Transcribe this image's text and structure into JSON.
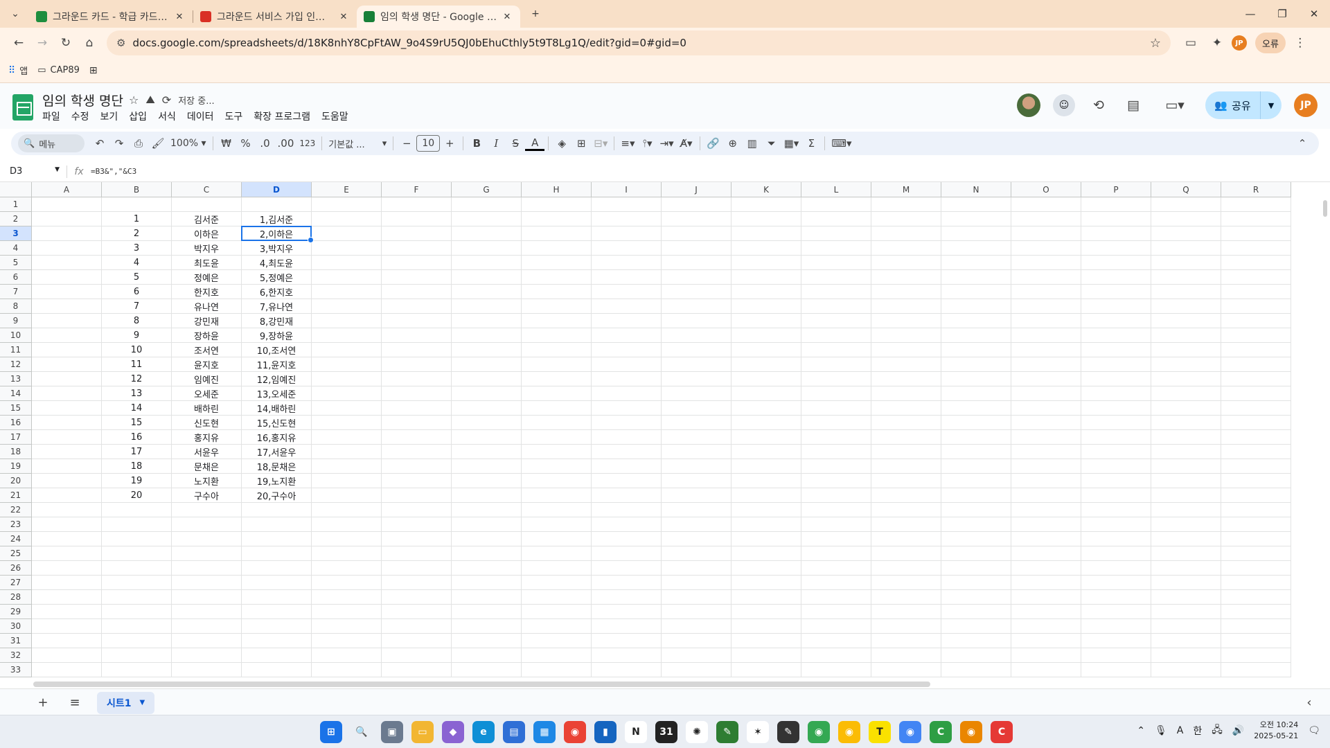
{
  "browser": {
    "tabs": [
      {
        "title": "그라운드 카드 - 학급 카드 관리",
        "active": false,
        "color": "#1e8e3e"
      },
      {
        "title": "그라운드 서비스 가입 인증 이메일",
        "active": false,
        "color": "#d93025"
      },
      {
        "title": "임의 학생 명단 - Google Sheets",
        "active": true,
        "color": "#188038"
      }
    ],
    "url": "docs.google.com/spreadsheets/d/18K8nhY8CpFtAW_9o4S9rU5QJ0bEhuCthly5t9T8Lg1Q/edit?gid=0#gid=0",
    "profile_initials": "JP",
    "error_label": "오류",
    "bookmarks": [
      {
        "label": "앱",
        "icon": "apps-icon"
      },
      {
        "label": "CAP89",
        "icon": "folder-icon"
      }
    ]
  },
  "doc": {
    "title": "임의 학생 명단",
    "save_status": "저장 중...",
    "menu": [
      "파일",
      "수정",
      "보기",
      "삽입",
      "서식",
      "데이터",
      "도구",
      "확장 프로그램",
      "도움말"
    ],
    "share_label": "공유",
    "avatar_initials": "JP"
  },
  "toolbar": {
    "menu_search": "메뉴",
    "zoom": "100%",
    "currency": "₩",
    "percent": "%",
    "dec_decrease": ".0",
    "dec_increase": ".00",
    "number_format": "123",
    "font": "기본값 ...",
    "font_size": "10"
  },
  "formula_bar": {
    "cell_ref": "D3",
    "formula": "=B3&\",\"&C3"
  },
  "grid": {
    "columns": [
      "A",
      "B",
      "C",
      "D",
      "E",
      "F",
      "G",
      "H",
      "I",
      "J",
      "K",
      "L",
      "M",
      "N",
      "O",
      "P",
      "Q",
      "R"
    ],
    "row_count": 33,
    "selected_col": "D",
    "selected_row": 3,
    "data": [
      {
        "b": "1",
        "c": "김서준",
        "d": "1,김서준"
      },
      {
        "b": "2",
        "c": "이하은",
        "d": "2,이하은"
      },
      {
        "b": "3",
        "c": "박지우",
        "d": "3,박지우"
      },
      {
        "b": "4",
        "c": "최도윤",
        "d": "4,최도윤"
      },
      {
        "b": "5",
        "c": "정예은",
        "d": "5,정예은"
      },
      {
        "b": "6",
        "c": "한지호",
        "d": "6,한지호"
      },
      {
        "b": "7",
        "c": "유나연",
        "d": "7,유나연"
      },
      {
        "b": "8",
        "c": "강민재",
        "d": "8,강민재"
      },
      {
        "b": "9",
        "c": "장하윤",
        "d": "9,장하윤"
      },
      {
        "b": "10",
        "c": "조서연",
        "d": "10,조서연"
      },
      {
        "b": "11",
        "c": "윤지호",
        "d": "11,윤지호"
      },
      {
        "b": "12",
        "c": "임예진",
        "d": "12,임예진"
      },
      {
        "b": "13",
        "c": "오세준",
        "d": "13,오세준"
      },
      {
        "b": "14",
        "c": "배하린",
        "d": "14,배하린"
      },
      {
        "b": "15",
        "c": "신도현",
        "d": "15,신도현"
      },
      {
        "b": "16",
        "c": "홍지유",
        "d": "16,홍지유"
      },
      {
        "b": "17",
        "c": "서윤우",
        "d": "17,서윤우"
      },
      {
        "b": "18",
        "c": "문채은",
        "d": "18,문채은"
      },
      {
        "b": "19",
        "c": "노지환",
        "d": "19,노지환"
      },
      {
        "b": "20",
        "c": "구수아",
        "d": "20,구수아"
      }
    ]
  },
  "sheets": [
    {
      "name": "시트1",
      "active": true
    }
  ],
  "taskbar": {
    "time": "오전 10:24",
    "date": "2025-05-21",
    "ime": "한",
    "lang": "A"
  },
  "colors": {
    "selection": "#1a73e8",
    "share_button": "#c2e7ff",
    "sheets_green": "#23a566"
  }
}
